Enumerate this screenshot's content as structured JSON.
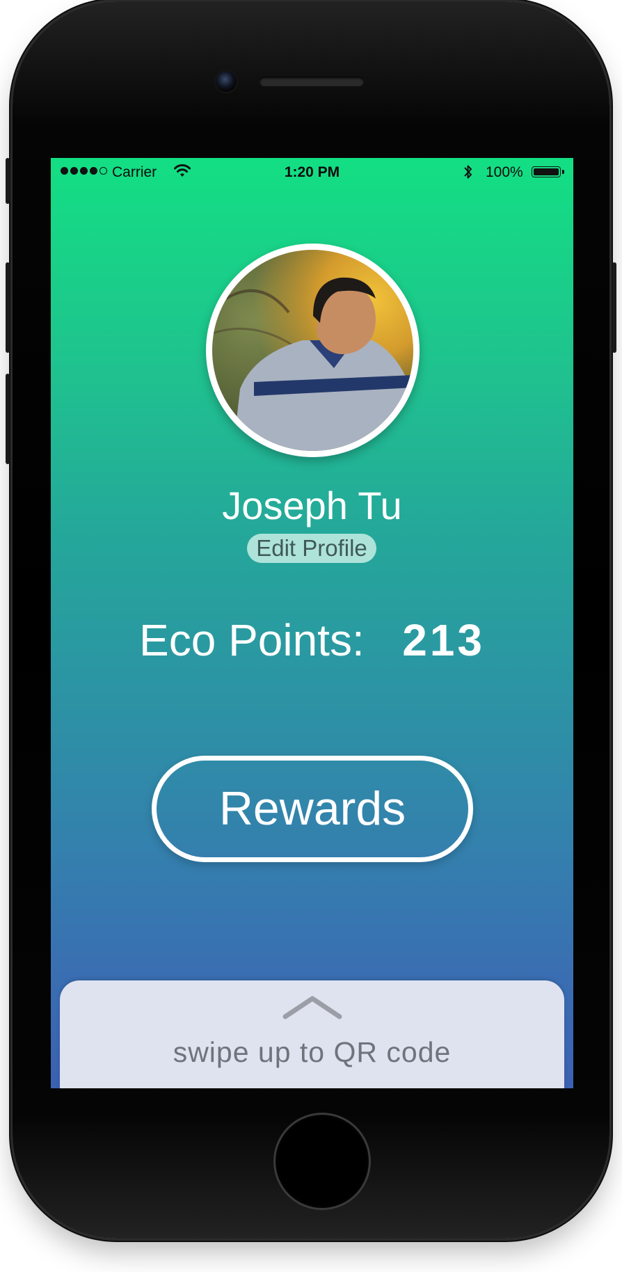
{
  "status_bar": {
    "carrier": "Carrier",
    "time": "1:20 PM",
    "battery": "100%"
  },
  "profile": {
    "name": "Joseph Tu",
    "edit_label": "Edit Profile"
  },
  "eco": {
    "label": "Eco Points:",
    "value": "213"
  },
  "rewards_label": "Rewards",
  "swipe_text": "swipe up to QR code",
  "icons": {
    "wifi": "wifi-icon",
    "bluetooth": "bluetooth-icon",
    "battery": "battery-icon",
    "chevron": "chevron-up-icon"
  },
  "colors": {
    "gradient_top": "#13df83",
    "gradient_bottom": "#3b61b2",
    "panel": "#dfe3ef"
  }
}
